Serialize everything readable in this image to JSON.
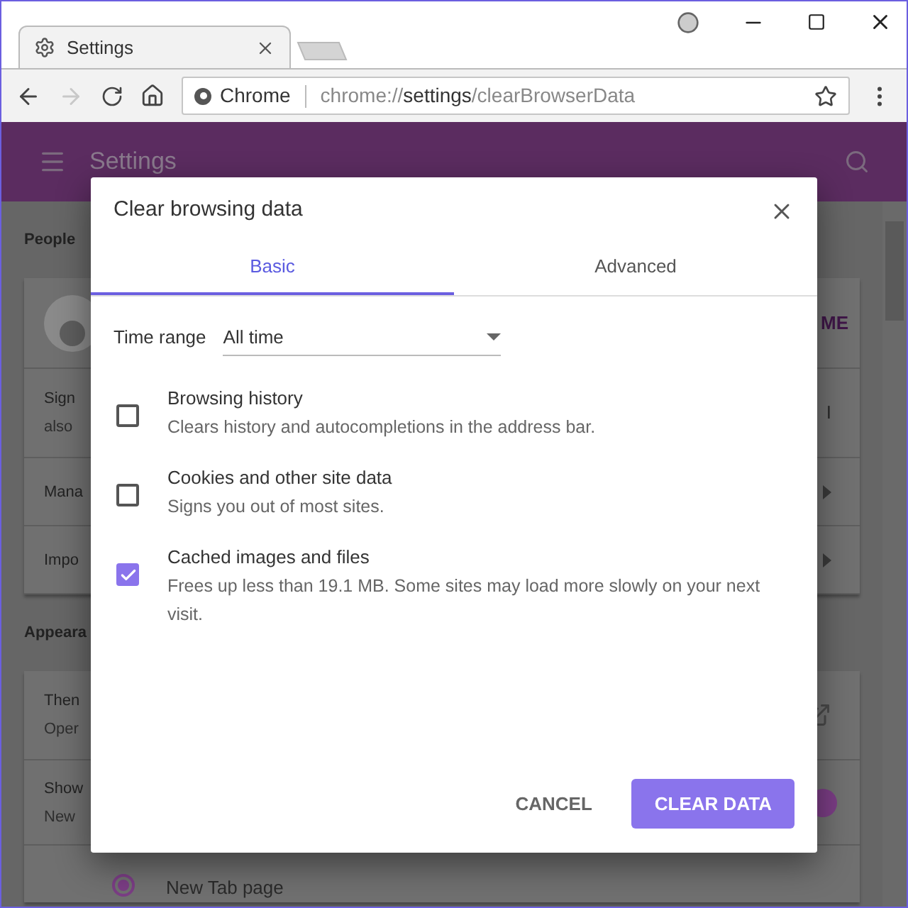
{
  "browser": {
    "tab": {
      "title": "Settings"
    },
    "omnibox": {
      "site": "Chrome",
      "url_prefix": "chrome://",
      "url_host": "settings",
      "url_path": "/clearBrowserData"
    },
    "forward_disabled": true
  },
  "header": {
    "title": "Settings"
  },
  "background": {
    "sections": [
      {
        "heading": "People",
        "rows": [
          {
            "kind": "avatar",
            "right": "ME"
          },
          {
            "kind": "text2",
            "lines": [
              "Sign",
              "also"
            ],
            "right": "I"
          },
          {
            "kind": "arrow",
            "lines": [
              "Mana"
            ]
          },
          {
            "kind": "arrow",
            "lines": [
              "Impo"
            ]
          }
        ]
      },
      {
        "heading": "Appeara",
        "rows": [
          {
            "kind": "external",
            "lines": [
              "Then",
              "Oper"
            ]
          },
          {
            "kind": "toggle",
            "lines": [
              "Show",
              "New"
            ],
            "on": true
          },
          {
            "kind": "radio",
            "label": "New Tab page",
            "selected": true
          }
        ]
      }
    ]
  },
  "dialog": {
    "title": "Clear browsing data",
    "tabs": [
      {
        "label": "Basic",
        "selected": true
      },
      {
        "label": "Advanced",
        "selected": false
      }
    ],
    "time_range": {
      "label": "Time range",
      "value": "All time"
    },
    "options": [
      {
        "label": "Browsing history",
        "description": "Clears history and autocompletions in the address bar.",
        "checked": false
      },
      {
        "label": "Cookies and other site data",
        "description": "Signs you out of most sites.",
        "checked": false
      },
      {
        "label": "Cached images and files",
        "description": "Frees up less than 19.1 MB. Some sites may load more slowly on your next visit.",
        "checked": true
      }
    ],
    "buttons": [
      {
        "label": "CANCEL",
        "kind": "text"
      },
      {
        "label": "CLEAR DATA",
        "kind": "primary"
      }
    ]
  }
}
